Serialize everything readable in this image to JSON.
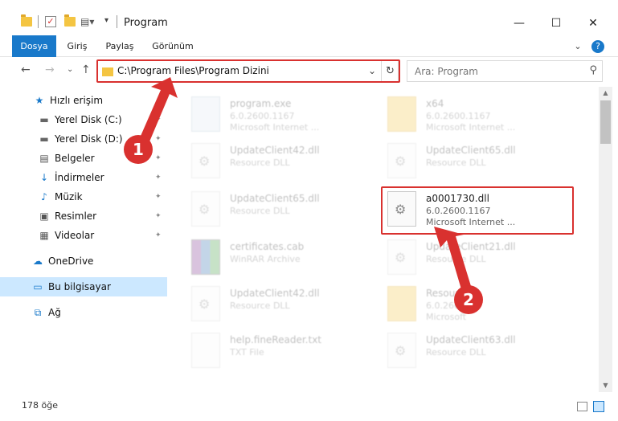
{
  "window": {
    "title": "Program",
    "minimize": "—",
    "maximize": "☐",
    "close": "✕"
  },
  "ribbon": {
    "tabs": [
      "Dosya",
      "Giriş",
      "Paylaş",
      "Görünüm"
    ],
    "expand": "⌄",
    "help": "?"
  },
  "nav": {
    "back": "←",
    "forward": "→",
    "recent": "⌄",
    "up": "↑",
    "address": "C:\\Program Files\\Program Dizini",
    "address_chevron": "⌄",
    "refresh": "↻",
    "search_placeholder": "Ara: Program",
    "search_icon": "⚲"
  },
  "sidebar": {
    "items": [
      {
        "label": "Hızlı erişim",
        "icon": "★",
        "icon_name": "quick-access-star-icon",
        "pinned": false
      },
      {
        "label": "Yerel Disk (C:)",
        "icon": "▬",
        "icon_name": "drive-icon",
        "pinned": true
      },
      {
        "label": "Yerel Disk (D:)",
        "icon": "▬",
        "icon_name": "drive-icon",
        "pinned": true
      },
      {
        "label": "Belgeler",
        "icon": "▤",
        "icon_name": "documents-icon",
        "pinned": true
      },
      {
        "label": "İndirmeler",
        "icon": "↓",
        "icon_name": "downloads-icon",
        "pinned": true
      },
      {
        "label": "Müzik",
        "icon": "♪",
        "icon_name": "music-icon",
        "pinned": true
      },
      {
        "label": "Resimler",
        "icon": "▣",
        "icon_name": "pictures-icon",
        "pinned": true
      },
      {
        "label": "Videolar",
        "icon": "▦",
        "icon_name": "videos-icon",
        "pinned": true
      },
      {
        "label": "OneDrive",
        "icon": "☁",
        "icon_name": "onedrive-cloud-icon",
        "pinned": false
      },
      {
        "label": "Bu bilgisayar",
        "icon": "▭",
        "icon_name": "computer-icon",
        "pinned": false
      },
      {
        "label": "Ağ",
        "icon": "⧉",
        "icon_name": "network-icon",
        "pinned": false
      }
    ],
    "pin_glyph": "📌"
  },
  "files": [
    {
      "name": "program.exe",
      "line1": "6.0.2600.1167",
      "line2": "Microsoft Internet ...",
      "kind": "exe"
    },
    {
      "name": "x64",
      "line1": "6.0.2600.1167",
      "line2": "Microsoft Internet ...",
      "kind": "folder"
    },
    {
      "name": "UpdateClient42.dll",
      "line1": "Resource DLL",
      "line2": "",
      "kind": "dll"
    },
    {
      "name": "UpdateClient65.dll",
      "line1": "Resource DLL",
      "line2": "",
      "kind": "dll"
    },
    {
      "name": "UpdateClient65.dll",
      "line1": "Resource DLL",
      "line2": "",
      "kind": "dll"
    },
    {
      "name": "a0001730.dll",
      "line1": "6.0.2600.1167",
      "line2": "Microsoft Internet ...",
      "kind": "dll",
      "highlighted": true
    },
    {
      "name": "certificates.cab",
      "line1": "WinRAR Archive",
      "line2": "",
      "kind": "rar"
    },
    {
      "name": "UpdateClient21.dll",
      "line1": "Resource DLL",
      "line2": "",
      "kind": "dll"
    },
    {
      "name": "UpdateClient42.dll",
      "line1": "Resource DLL",
      "line2": "",
      "kind": "dll"
    },
    {
      "name": "Resource",
      "line1": "6.0.2600",
      "line2": "Microsoft",
      "kind": "folder"
    },
    {
      "name": "help.fineReader.txt",
      "line1": "TXT File",
      "line2": "",
      "kind": "txt"
    },
    {
      "name": "UpdateClient63.dll",
      "line1": "Resource DLL",
      "line2": "",
      "kind": "dll"
    }
  ],
  "status": {
    "item_count": "178 öğe"
  },
  "annotations": {
    "step1": "1",
    "step2": "2",
    "accent": "#d9312f"
  },
  "colors": {
    "file_tab": "#1979ca",
    "selected": "#cce8ff"
  }
}
